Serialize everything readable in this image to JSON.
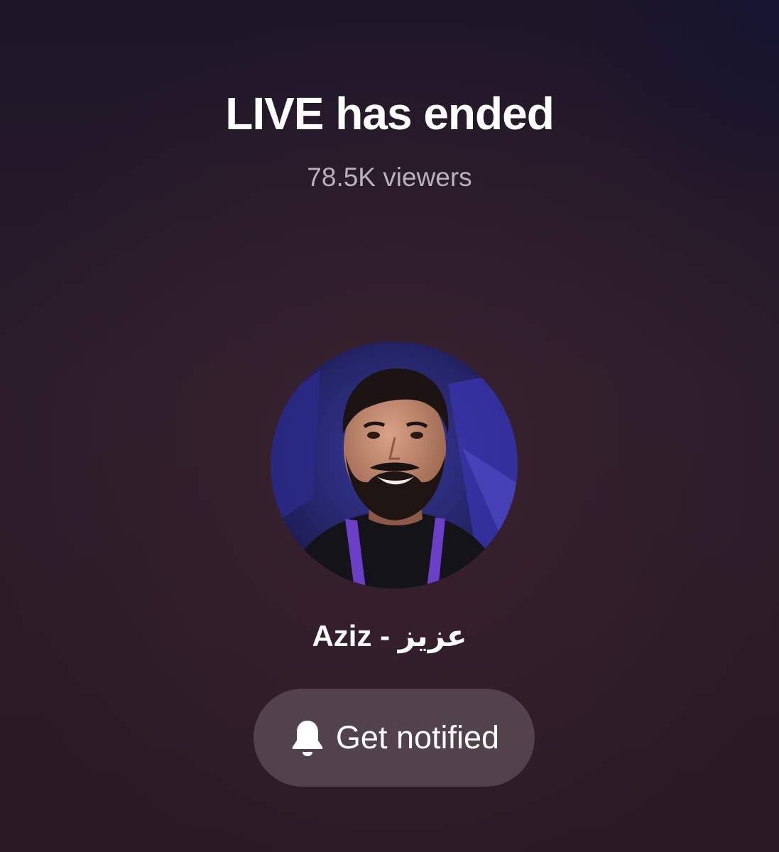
{
  "header": {
    "title": "LIVE has ended",
    "viewers": "78.5K viewers"
  },
  "profile": {
    "avatar_icon": "avatar-photo",
    "username": "Aziz - عزيز"
  },
  "actions": {
    "notify_label": "Get notified",
    "notify_icon": "bell-icon"
  },
  "colors": {
    "background": "#2a1c2a",
    "button_background": "#5a4c54",
    "title_text": "#ffffff",
    "secondary_text": "#b9b3b9"
  }
}
